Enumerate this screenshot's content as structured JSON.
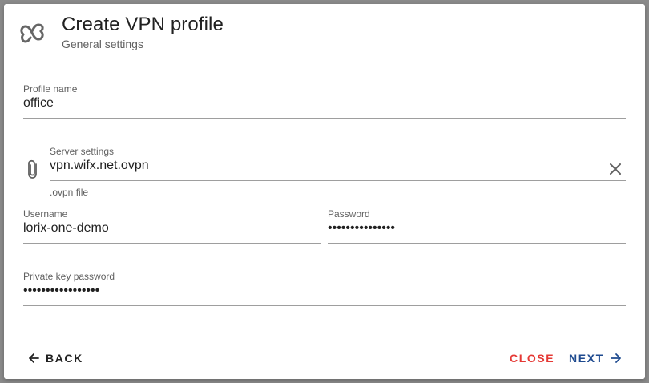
{
  "dialog": {
    "title": "Create VPN profile",
    "subtitle": "General settings",
    "icon": "vpn-logo-icon"
  },
  "fields": {
    "profile_name": {
      "label": "Profile name",
      "value": "office"
    },
    "server_settings": {
      "label": "Server settings",
      "value": "vpn.wifx.net.ovpn",
      "hint": ".ovpn file",
      "icon": "paperclip-icon",
      "clear_icon": "close-icon"
    },
    "username": {
      "label": "Username",
      "value": "lorix-one-demo"
    },
    "password": {
      "label": "Password",
      "value": "•••••••••••••••"
    },
    "private_key_password": {
      "label": "Private key password",
      "value": "•••••••••••••••••"
    }
  },
  "actions": {
    "back": {
      "label": "BACK",
      "icon": "arrow-left-icon",
      "color": "#212121"
    },
    "close": {
      "label": "CLOSE",
      "color": "#e53935"
    },
    "next": {
      "label": "NEXT",
      "icon": "arrow-right-icon",
      "color": "#1e4a8f"
    }
  }
}
